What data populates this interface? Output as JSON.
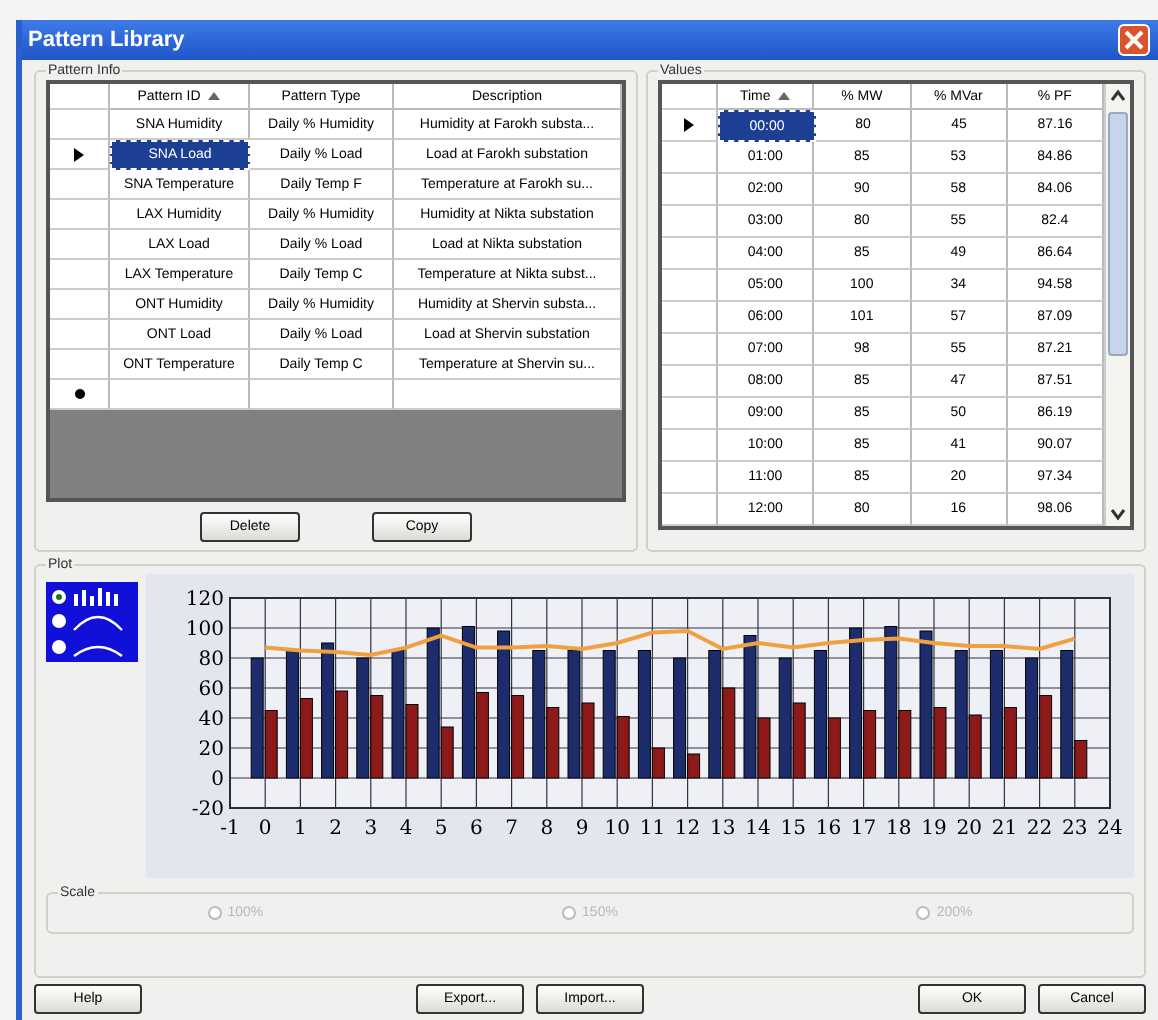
{
  "window": {
    "title": "Pattern Library"
  },
  "pattern_info": {
    "title": "Pattern Info",
    "columns": [
      {
        "label": "Pattern ID",
        "sorted": true
      },
      {
        "label": "Pattern Type",
        "sorted": false
      },
      {
        "label": "Description",
        "sorted": false
      }
    ],
    "rows": [
      {
        "cells": [
          "SNA Humidity",
          "Daily % Humidity",
          "Humidity at Farokh substa..."
        ],
        "selected": false
      },
      {
        "cells": [
          "SNA Load",
          "Daily % Load",
          "Load at Farokh substation"
        ],
        "selected": true
      },
      {
        "cells": [
          "SNA Temperature",
          "Daily Temp F",
          "Temperature at Farokh su..."
        ],
        "selected": false
      },
      {
        "cells": [
          "LAX Humidity",
          "Daily % Humidity",
          "Humidity at Nikta substation"
        ],
        "selected": false
      },
      {
        "cells": [
          "LAX Load",
          "Daily % Load",
          "Load at Nikta substation"
        ],
        "selected": false
      },
      {
        "cells": [
          "LAX Temperature",
          "Daily Temp C",
          "Temperature at Nikta subst..."
        ],
        "selected": false
      },
      {
        "cells": [
          "ONT Humidity",
          "Daily % Humidity",
          "Humidity at Shervin substa..."
        ],
        "selected": false
      },
      {
        "cells": [
          "ONT Load",
          "Daily % Load",
          "Load at Shervin substation"
        ],
        "selected": false
      },
      {
        "cells": [
          "ONT Temperature",
          "Daily Temp C",
          "Temperature at Shervin su..."
        ],
        "selected": false
      }
    ],
    "buttons": [
      "Delete",
      "Copy"
    ]
  },
  "values": {
    "title": "Values",
    "columns": [
      {
        "label": "Time",
        "sorted": true
      },
      {
        "label": "% MW",
        "sorted": false
      },
      {
        "label": "% MVar",
        "sorted": false
      },
      {
        "label": "% PF",
        "sorted": false
      }
    ],
    "rows": [
      {
        "cells": [
          "00:00",
          "80",
          "45",
          "87.16"
        ],
        "selected": true
      },
      {
        "cells": [
          "01:00",
          "85",
          "53",
          "84.86"
        ],
        "selected": false
      },
      {
        "cells": [
          "02:00",
          "90",
          "58",
          "84.06"
        ],
        "selected": false
      },
      {
        "cells": [
          "03:00",
          "80",
          "55",
          "82.4"
        ],
        "selected": false
      },
      {
        "cells": [
          "04:00",
          "85",
          "49",
          "86.64"
        ],
        "selected": false
      },
      {
        "cells": [
          "05:00",
          "100",
          "34",
          "94.58"
        ],
        "selected": false
      },
      {
        "cells": [
          "06:00",
          "101",
          "57",
          "87.09"
        ],
        "selected": false
      },
      {
        "cells": [
          "07:00",
          "98",
          "55",
          "87.21"
        ],
        "selected": false
      },
      {
        "cells": [
          "08:00",
          "85",
          "47",
          "87.51"
        ],
        "selected": false
      },
      {
        "cells": [
          "09:00",
          "85",
          "50",
          "86.19"
        ],
        "selected": false
      },
      {
        "cells": [
          "10:00",
          "85",
          "41",
          "90.07"
        ],
        "selected": false
      },
      {
        "cells": [
          "11:00",
          "85",
          "20",
          "97.34"
        ],
        "selected": false
      },
      {
        "cells": [
          "12:00",
          "80",
          "16",
          "98.06"
        ],
        "selected": false
      }
    ]
  },
  "plot": {
    "title": "Plot",
    "plot_types": [
      {
        "selected": true
      },
      {
        "selected": false
      },
      {
        "selected": false
      }
    ],
    "chart_data": {
      "type": "bar",
      "x": [
        0,
        1,
        2,
        3,
        4,
        5,
        6,
        7,
        8,
        9,
        10,
        11,
        12,
        13,
        14,
        15,
        16,
        17,
        18,
        19,
        20,
        21,
        22,
        23
      ],
      "series": [
        {
          "type": "bar",
          "color": "#1c2c6c",
          "values": [
            80,
            85,
            90,
            80,
            85,
            100,
            101,
            98,
            85,
            85,
            85,
            85,
            80,
            85,
            95,
            80,
            85,
            100,
            101,
            98,
            85,
            85,
            80,
            85
          ]
        },
        {
          "type": "bar",
          "color": "#8c1a1a",
          "values": [
            45,
            53,
            58,
            55,
            49,
            34,
            57,
            55,
            47,
            50,
            41,
            20,
            16,
            60,
            40,
            50,
            40,
            45,
            45,
            47,
            42,
            47,
            55,
            25
          ]
        },
        {
          "type": "line",
          "color": "#f0a040",
          "values": [
            87,
            85,
            84,
            82,
            87,
            95,
            87,
            87,
            88,
            86,
            90,
            97,
            98,
            86,
            90,
            87,
            90,
            92,
            93,
            90,
            88,
            88,
            86,
            93
          ]
        }
      ],
      "xlim": [
        -1,
        24
      ],
      "ylim": [
        -20,
        120
      ],
      "xticks": [
        -1,
        0,
        1,
        2,
        3,
        4,
        5,
        6,
        7,
        8,
        9,
        10,
        11,
        12,
        13,
        14,
        15,
        16,
        17,
        18,
        19,
        20,
        21,
        22,
        23,
        24
      ],
      "yticks": [
        -20,
        0,
        20,
        40,
        60,
        80,
        100,
        120
      ],
      "grid": true
    }
  },
  "scale": {
    "title": "Scale",
    "options": [
      {
        "label": "100%",
        "selected": false,
        "disabled": true
      },
      {
        "label": "150%",
        "selected": false,
        "disabled": true
      },
      {
        "label": "200%",
        "selected": false,
        "disabled": true
      }
    ]
  },
  "footer": {
    "left_buttons": [
      "Help"
    ],
    "center_buttons": [
      "Export...",
      "Import..."
    ],
    "right_buttons": [
      "OK",
      "Cancel"
    ]
  }
}
